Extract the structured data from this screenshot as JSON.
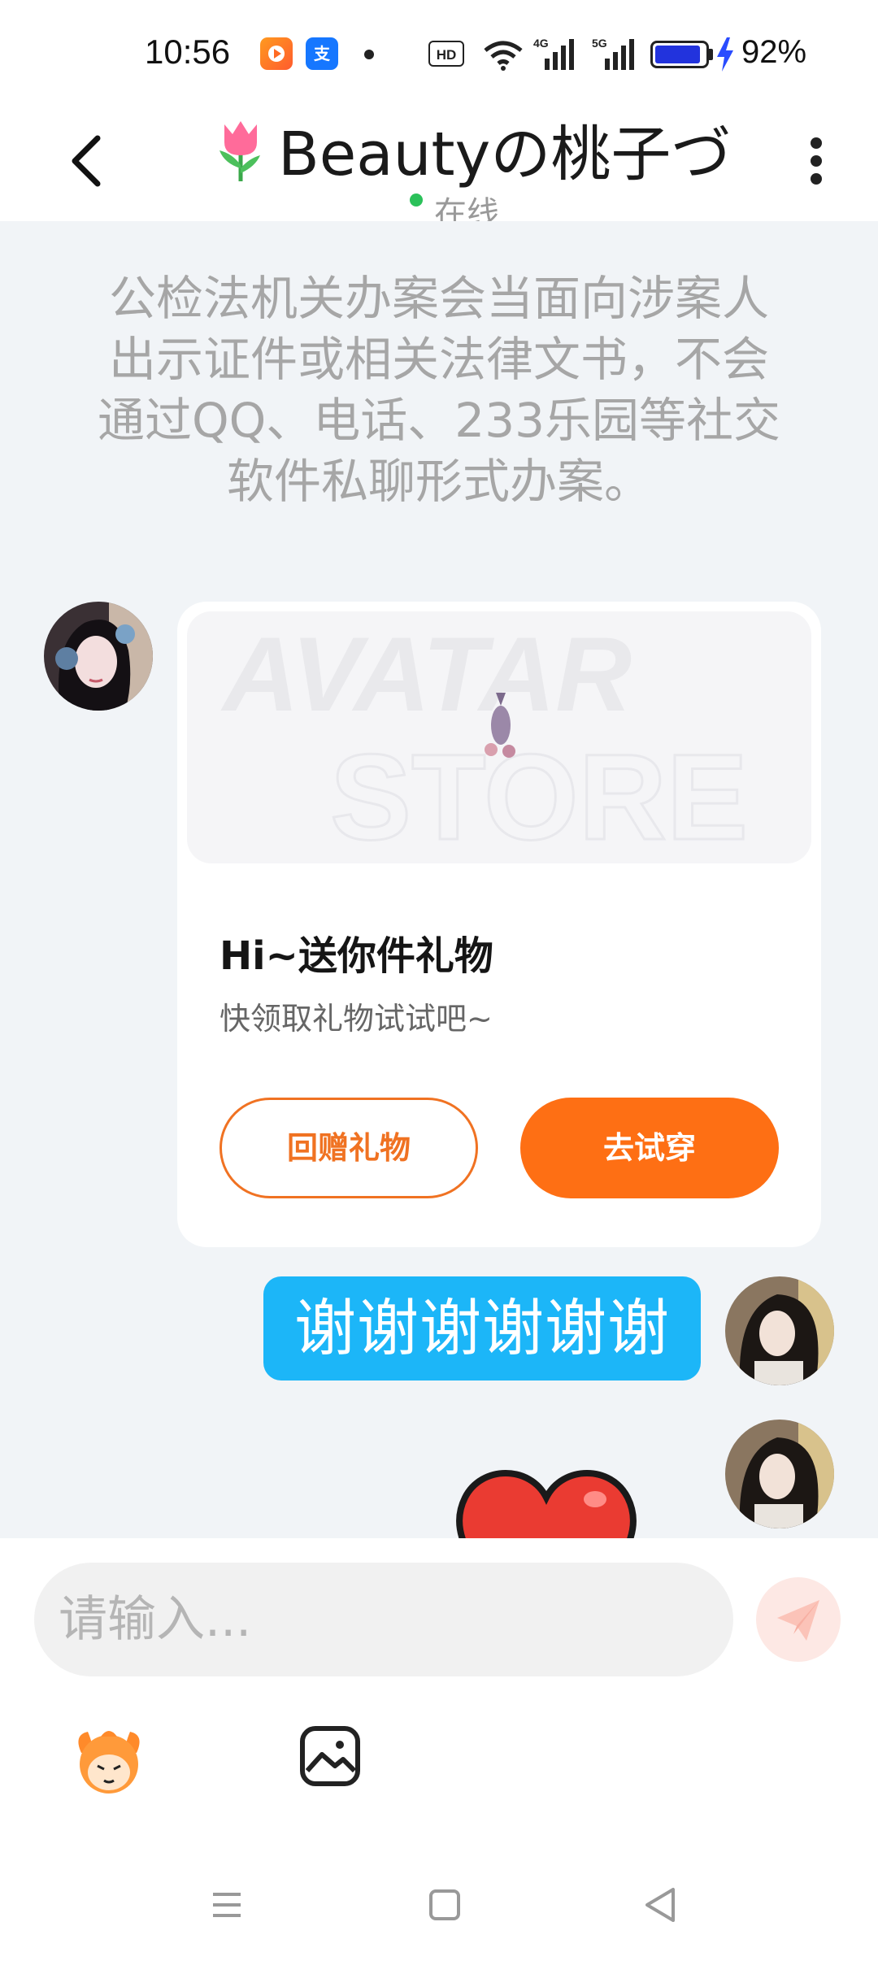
{
  "status_bar": {
    "time": "10:56",
    "battery_percent": "92%",
    "battery_level": 0.92,
    "app_badges": [
      "video-app-icon",
      "alipay-icon"
    ],
    "alipay_glyph": "支"
  },
  "header": {
    "title": "Beautyの桃子づ",
    "title_emoji": "tulip-icon",
    "status": "在线",
    "status_color": "#2bc15a"
  },
  "chat": {
    "notice": "公检法机关办案会当面向涉案人出示证件或相关法律文书，不会通过QQ、电话、233乐园等社交软件私聊形式办案。",
    "gift_card": {
      "image_text_line1": "AVATAR",
      "image_text_line2": "STORE",
      "title": "Hi~送你件礼物",
      "subtitle": "快领取礼物试试吧~",
      "return_gift_label": "回赠礼物",
      "try_on_label": "去试穿",
      "accent_color": "#fe6f14"
    },
    "my_message": "谢谢谢谢谢谢",
    "my_bubble_color": "#1cb6f8",
    "sticker": "heart-sticker"
  },
  "input": {
    "placeholder": "请输入..."
  }
}
